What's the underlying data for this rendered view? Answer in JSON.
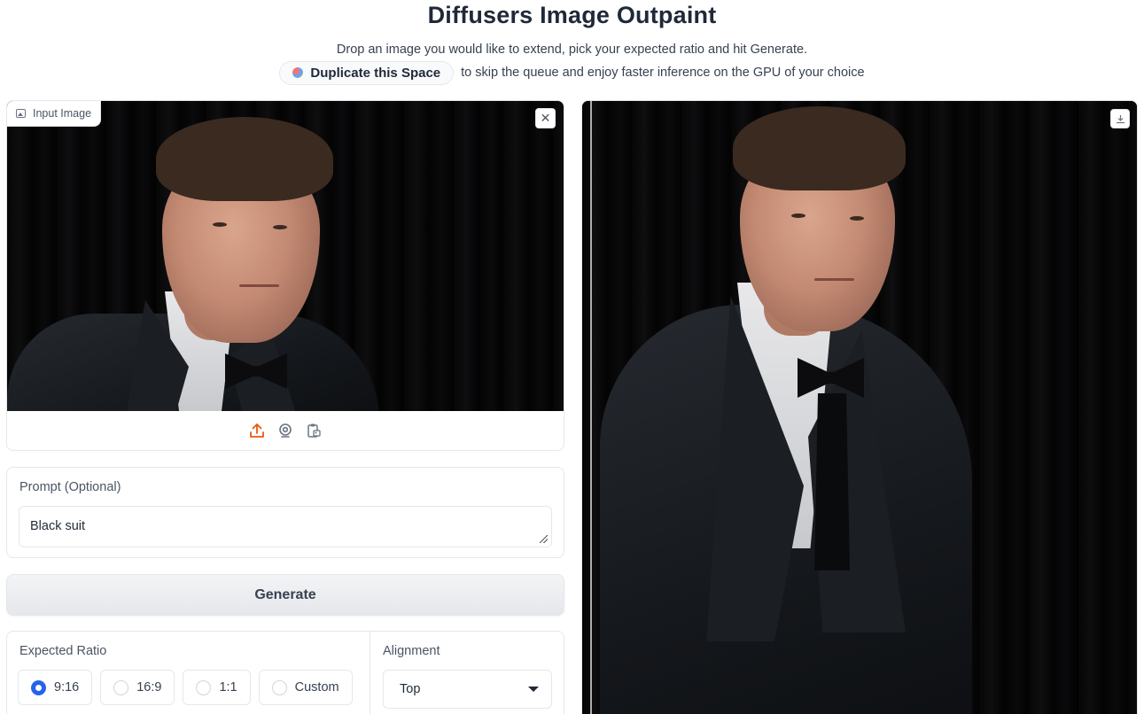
{
  "header": {
    "title": "Diffusers Image Outpaint",
    "subtitle": "Drop an image you would like to extend, pick your expected ratio and hit Generate.",
    "duplicate_label": "Duplicate this Space",
    "duplicate_suffix": "to skip the queue and enjoy faster inference on the GPU of your choice"
  },
  "input_image": {
    "label": "Input Image",
    "clear_icon": "close-icon",
    "sources": [
      "upload-icon",
      "webcam-icon",
      "clipboard-icon"
    ]
  },
  "prompt": {
    "label": "Prompt (Optional)",
    "value": "Black suit"
  },
  "generate": {
    "label": "Generate"
  },
  "ratio": {
    "label": "Expected Ratio",
    "options": [
      "9:16",
      "16:9",
      "1:1",
      "Custom"
    ],
    "selected": "9:16"
  },
  "alignment": {
    "label": "Alignment",
    "value": "Top"
  },
  "output_image": {
    "download_icon": "download-icon"
  },
  "colors": {
    "accent": "#2563eb",
    "upload_icon": "#ea580c",
    "panel_border": "#e5e7eb"
  }
}
